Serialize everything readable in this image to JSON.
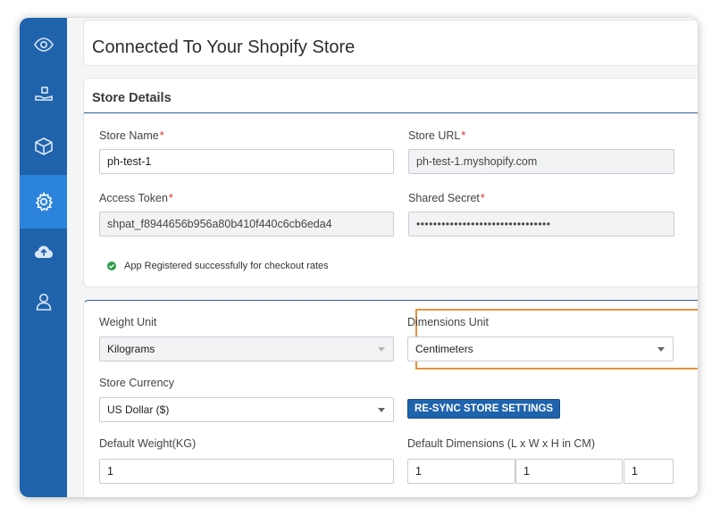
{
  "colors": {
    "sidebar": "#1f63ad",
    "sidebar_active": "#2b83dc",
    "accent_border": "#e8923a",
    "button": "#1f63ad",
    "success": "#2e9e49",
    "required": "#d93025"
  },
  "sidebar": {
    "items": [
      {
        "icon": "eye-icon",
        "active": false
      },
      {
        "icon": "hand-package-icon",
        "active": false
      },
      {
        "icon": "box-icon",
        "active": false
      },
      {
        "icon": "gear-icon",
        "active": true
      },
      {
        "icon": "cloud-upload-icon",
        "active": false
      },
      {
        "icon": "user-icon",
        "active": false
      }
    ]
  },
  "header": {
    "title": "Connected To Your Shopify Store"
  },
  "store_details": {
    "title": "Store Details",
    "store_name": {
      "label": "Store Name",
      "required": "*",
      "value": "ph-test-1"
    },
    "store_url": {
      "label": "Store URL",
      "required": "*",
      "value": "ph-test-1.myshopify.com"
    },
    "access_token": {
      "label": "Access Token",
      "required": "*",
      "value": "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"
    },
    "shared_secret": {
      "label": "Shared Secret",
      "required": "*",
      "value": "••••••••••••••••••••••••••••••••"
    },
    "success_message": "App Registered successfully for checkout rates"
  },
  "settings": {
    "weight_unit": {
      "label": "Weight Unit",
      "value": "Kilograms"
    },
    "dimensions_unit": {
      "label": "Dimensions Unit",
      "value": "Centimeters"
    },
    "store_currency": {
      "label": "Store Currency",
      "value": "US Dollar ($)"
    },
    "resync_button": "RE-SYNC STORE SETTINGS",
    "default_weight": {
      "label": "Default Weight(KG)",
      "value": "1"
    },
    "default_dimensions": {
      "label": "Default Dimensions (L x W x H in CM)",
      "length": "1",
      "width": "1",
      "height": "1"
    }
  }
}
